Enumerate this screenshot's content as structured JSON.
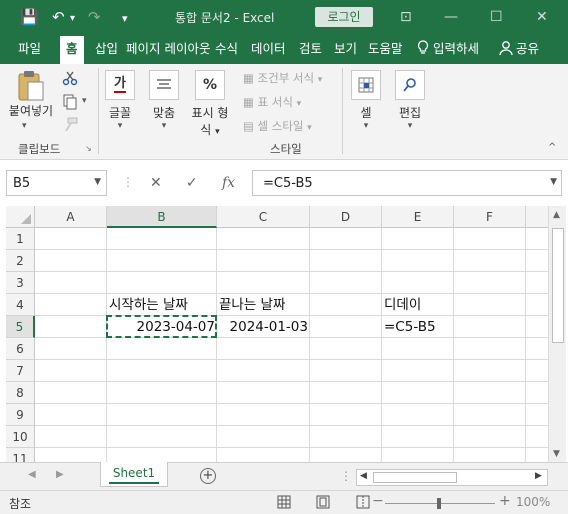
{
  "titlebar": {
    "title": "통합 문서2  -  Excel",
    "login_label": "로그인",
    "save_glyph": "💾",
    "undo_glyph": "↶",
    "redo_glyph": "↷",
    "customize_glyph": "▾",
    "ribbon_options_glyph": "⊡",
    "minimize_glyph": "—",
    "restore_glyph": "☐",
    "close_glyph": "✕"
  },
  "tabs": {
    "file": "파일",
    "home": "홈",
    "insert": "삽입",
    "page_layout": "페이지 레이아웃",
    "formulas": "수식",
    "data": "데이터",
    "review": "검토",
    "view": "보기",
    "help": "도움말",
    "tell_me": "입력하세",
    "share": "공유"
  },
  "ribbon": {
    "paste": "붙여넣기",
    "clipboard_group": "클립보드",
    "font": "글꼴",
    "font_glyph": "가",
    "alignment": "맞춤",
    "number_line1": "표시 형",
    "number_line2": "식",
    "number_glyph": "%",
    "conditional_format": "조건부 서식",
    "format_as_table": "표 서식",
    "cell_styles": "셀 스타일",
    "styles_group": "스타일",
    "cells": "셀",
    "editing": "편집"
  },
  "formula_bar": {
    "name_box": "B5",
    "cancel_glyph": "✕",
    "enter_glyph": "✓",
    "fx_glyph": "fx",
    "formula": "=C5-B5"
  },
  "grid": {
    "columns": [
      "A",
      "B",
      "C",
      "D",
      "E",
      "F"
    ],
    "rows": [
      "1",
      "2",
      "3",
      "4",
      "5",
      "6",
      "7",
      "8",
      "9",
      "10",
      "11"
    ],
    "cells": {
      "B4": "시작하는 날짜",
      "C4": "끝나는 날짜",
      "E4": "디데이",
      "B5": "2023-04-07",
      "C5": "2024-01-03",
      "E5": "=C5-B5"
    }
  },
  "sheets": {
    "active": "Sheet1",
    "add_glyph": "+"
  },
  "status": {
    "mode": "참조",
    "zoom": "100%"
  },
  "colors": {
    "accent": "#217346",
    "ribbon_bg": "#f3f3f3"
  }
}
